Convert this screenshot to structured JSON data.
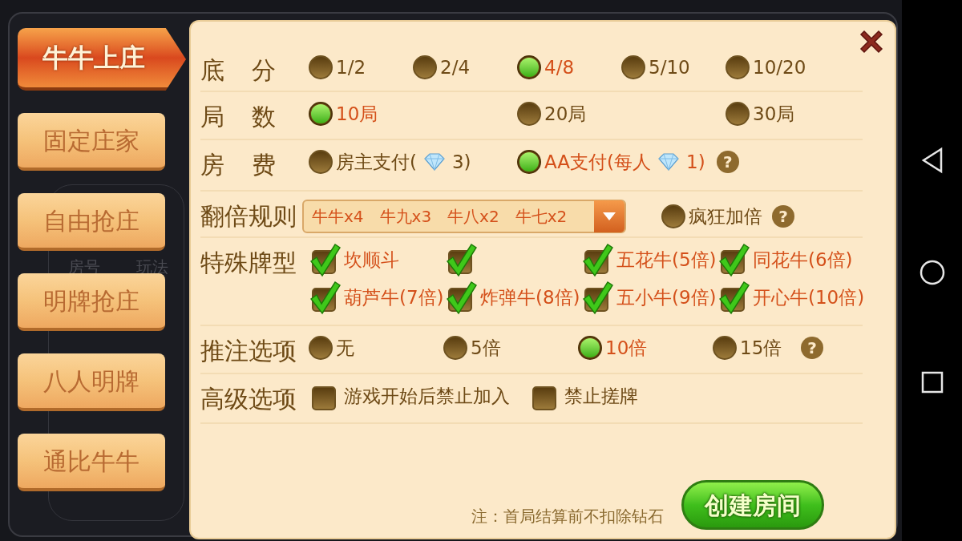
{
  "background_labels": [
    "房号",
    "玩法"
  ],
  "tabs": [
    {
      "label": "牛牛上庄",
      "selected": true
    },
    {
      "label": "固定庄家",
      "selected": false
    },
    {
      "label": "自由抢庄",
      "selected": false
    },
    {
      "label": "明牌抢庄",
      "selected": false
    },
    {
      "label": "八人明牌",
      "selected": false
    },
    {
      "label": "通比牛牛",
      "selected": false
    }
  ],
  "rows": [
    {
      "kind": "radio",
      "label": "底 分",
      "options": [
        {
          "text": "1/2",
          "selected": false
        },
        {
          "text": "2/4",
          "selected": false
        },
        {
          "text": "4/8",
          "selected": true
        },
        {
          "text": "5/10",
          "selected": false
        },
        {
          "text": "10/20",
          "selected": false
        }
      ]
    },
    {
      "kind": "radio",
      "label": "局 数",
      "options": [
        {
          "text": "10局",
          "selected": true
        },
        {
          "text": "20局",
          "selected": false
        },
        {
          "text": "30局",
          "selected": false
        }
      ]
    },
    {
      "kind": "radio",
      "label": "房 费",
      "help": "?",
      "options": [
        {
          "text": "房主支付(",
          "text_after": "3)",
          "selected": false
        },
        {
          "text": "AA支付(每人",
          "text_after": "1)",
          "selected": true
        }
      ]
    },
    {
      "kind": "dropdown",
      "label": "翻倍规则",
      "value": "牛牛x4　牛九x3　牛八x2　牛七x2",
      "help": "?",
      "options": [
        {
          "text": "疯狂加倍",
          "selected": false
        }
      ]
    },
    {
      "kind": "checkbox",
      "label": "特殊牌型",
      "options": [
        {
          "text": "坎顺斗",
          "checked": true
        },
        {
          "checked": true
        },
        {
          "text": "五花牛(5倍)",
          "checked": true
        },
        {
          "text": "同花牛(6倍)",
          "checked": true
        },
        {
          "text": "葫芦牛(7倍)",
          "checked": true
        },
        {
          "text": "炸弹牛(8倍)",
          "checked": true
        },
        {
          "text": "五小牛(9倍)",
          "checked": true
        },
        {
          "text": "开心牛(10倍)",
          "checked": true
        }
      ]
    },
    {
      "kind": "radio",
      "label": "推注选项",
      "help": "?",
      "options": [
        {
          "text": "无",
          "selected": false
        },
        {
          "text": "5倍",
          "selected": false
        },
        {
          "text": "10倍",
          "selected": true
        },
        {
          "text": "15倍",
          "selected": false
        }
      ]
    },
    {
      "kind": "checkbox",
      "label": "高级选项",
      "options": [
        {
          "text": "游戏开始后禁止加入",
          "checked": false
        },
        {
          "text": "禁止搓牌",
          "checked": false
        }
      ]
    }
  ],
  "note": "注：首局结算前不扣除钻石",
  "create_button": "创建房间"
}
